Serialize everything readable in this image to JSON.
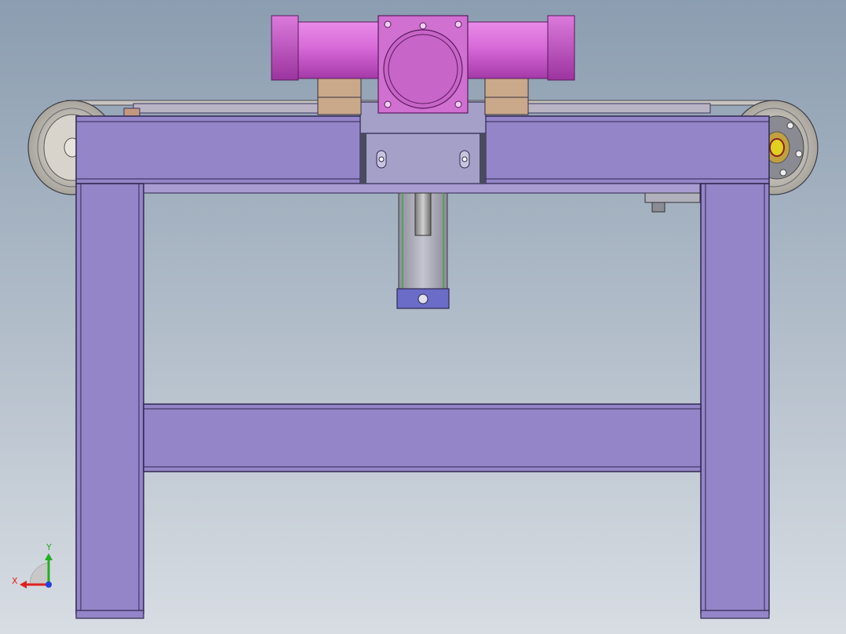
{
  "view": {
    "background_top": "#8b9db0",
    "background_bottom": "#d8dde3"
  },
  "colors": {
    "frame": "#9485c8",
    "frame_edge": "#3a3460",
    "cylinder": "#d86ad8",
    "cylinder_dark": "#b046b4",
    "block": "#c9a98a",
    "steel": "#a8a8b4",
    "roller": "#c8c4bc"
  },
  "triad": {
    "x_label": "X",
    "y_label": "Y",
    "x_color": "#e02020",
    "y_color": "#20b020",
    "z_color": "#2040e0"
  }
}
